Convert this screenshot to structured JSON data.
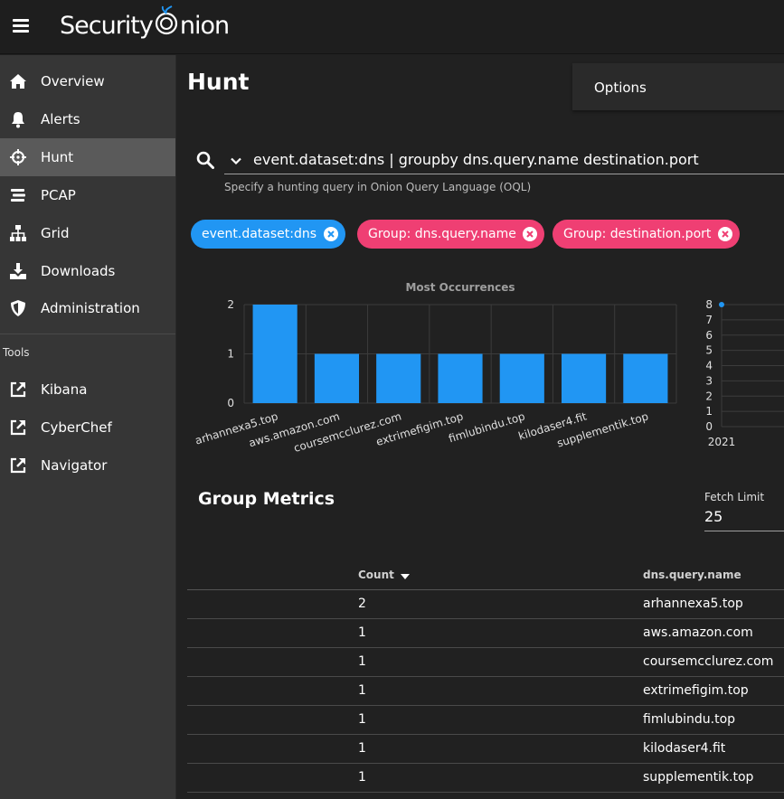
{
  "app": {
    "brand": "Security Onion"
  },
  "sidebar": {
    "items": [
      {
        "label": "Overview",
        "icon": "home-icon",
        "active": false
      },
      {
        "label": "Alerts",
        "icon": "bell-icon",
        "active": false
      },
      {
        "label": "Hunt",
        "icon": "crosshairs-icon",
        "active": true
      },
      {
        "label": "PCAP",
        "icon": "stream-icon",
        "active": false
      },
      {
        "label": "Grid",
        "icon": "sitemap-icon",
        "active": false
      },
      {
        "label": "Downloads",
        "icon": "download-icon",
        "active": false
      },
      {
        "label": "Administration",
        "icon": "shield-icon",
        "active": false
      }
    ],
    "tools_heading": "Tools",
    "tools": [
      {
        "label": "Kibana",
        "icon": "external-link-icon"
      },
      {
        "label": "CyberChef",
        "icon": "external-link-icon"
      },
      {
        "label": "Navigator",
        "icon": "external-link-icon"
      }
    ]
  },
  "main": {
    "title": "Hunt",
    "options_label": "Options",
    "query": "event.dataset:dns | groupby dns.query.name destination.port",
    "query_hint": "Specify a hunting query in Onion Query Language (OQL)",
    "chips": [
      {
        "label": "event.dataset:dns",
        "color": "#2196f3"
      },
      {
        "label": "Group: dns.query.name",
        "color": "#ef3f73"
      },
      {
        "label": "Group: destination.port",
        "color": "#ef3f73"
      }
    ]
  },
  "chart_data": [
    {
      "type": "bar",
      "title": "Most Occurrences",
      "categories": [
        "arhannexa5.top",
        "aws.amazon.com",
        "coursemcclurez.com",
        "extrimefigim.top",
        "fimlubindu.top",
        "kilodaser4.fit",
        "supplementik.top"
      ],
      "values": [
        2,
        1,
        1,
        1,
        1,
        1,
        1
      ],
      "ylim": [
        0,
        2
      ],
      "yticks": [
        "0",
        "1",
        "2"
      ],
      "color": "#2196f3",
      "grid": true
    },
    {
      "type": "scatter",
      "yticks": [
        "0",
        "1",
        "2",
        "3",
        "4",
        "5",
        "6",
        "7",
        "8"
      ],
      "xticks": [
        "2021"
      ],
      "ylim": [
        0,
        8
      ],
      "points": [
        {
          "x": "2021",
          "y": 8
        }
      ],
      "color": "#2196f3",
      "grid": true
    }
  ],
  "metrics": {
    "title": "Group Metrics",
    "fetch_limit_label": "Fetch Limit",
    "fetch_limit_value": "25",
    "columns": {
      "count": "Count",
      "name": "dns.query.name"
    },
    "rows": [
      {
        "count": "2",
        "name": "arhannexa5.top"
      },
      {
        "count": "1",
        "name": "aws.amazon.com"
      },
      {
        "count": "1",
        "name": "coursemcclurez.com"
      },
      {
        "count": "1",
        "name": "extrimefigim.top"
      },
      {
        "count": "1",
        "name": "fimlubindu.top"
      },
      {
        "count": "1",
        "name": "kilodaser4.fit"
      },
      {
        "count": "1",
        "name": "supplementik.top"
      }
    ]
  }
}
